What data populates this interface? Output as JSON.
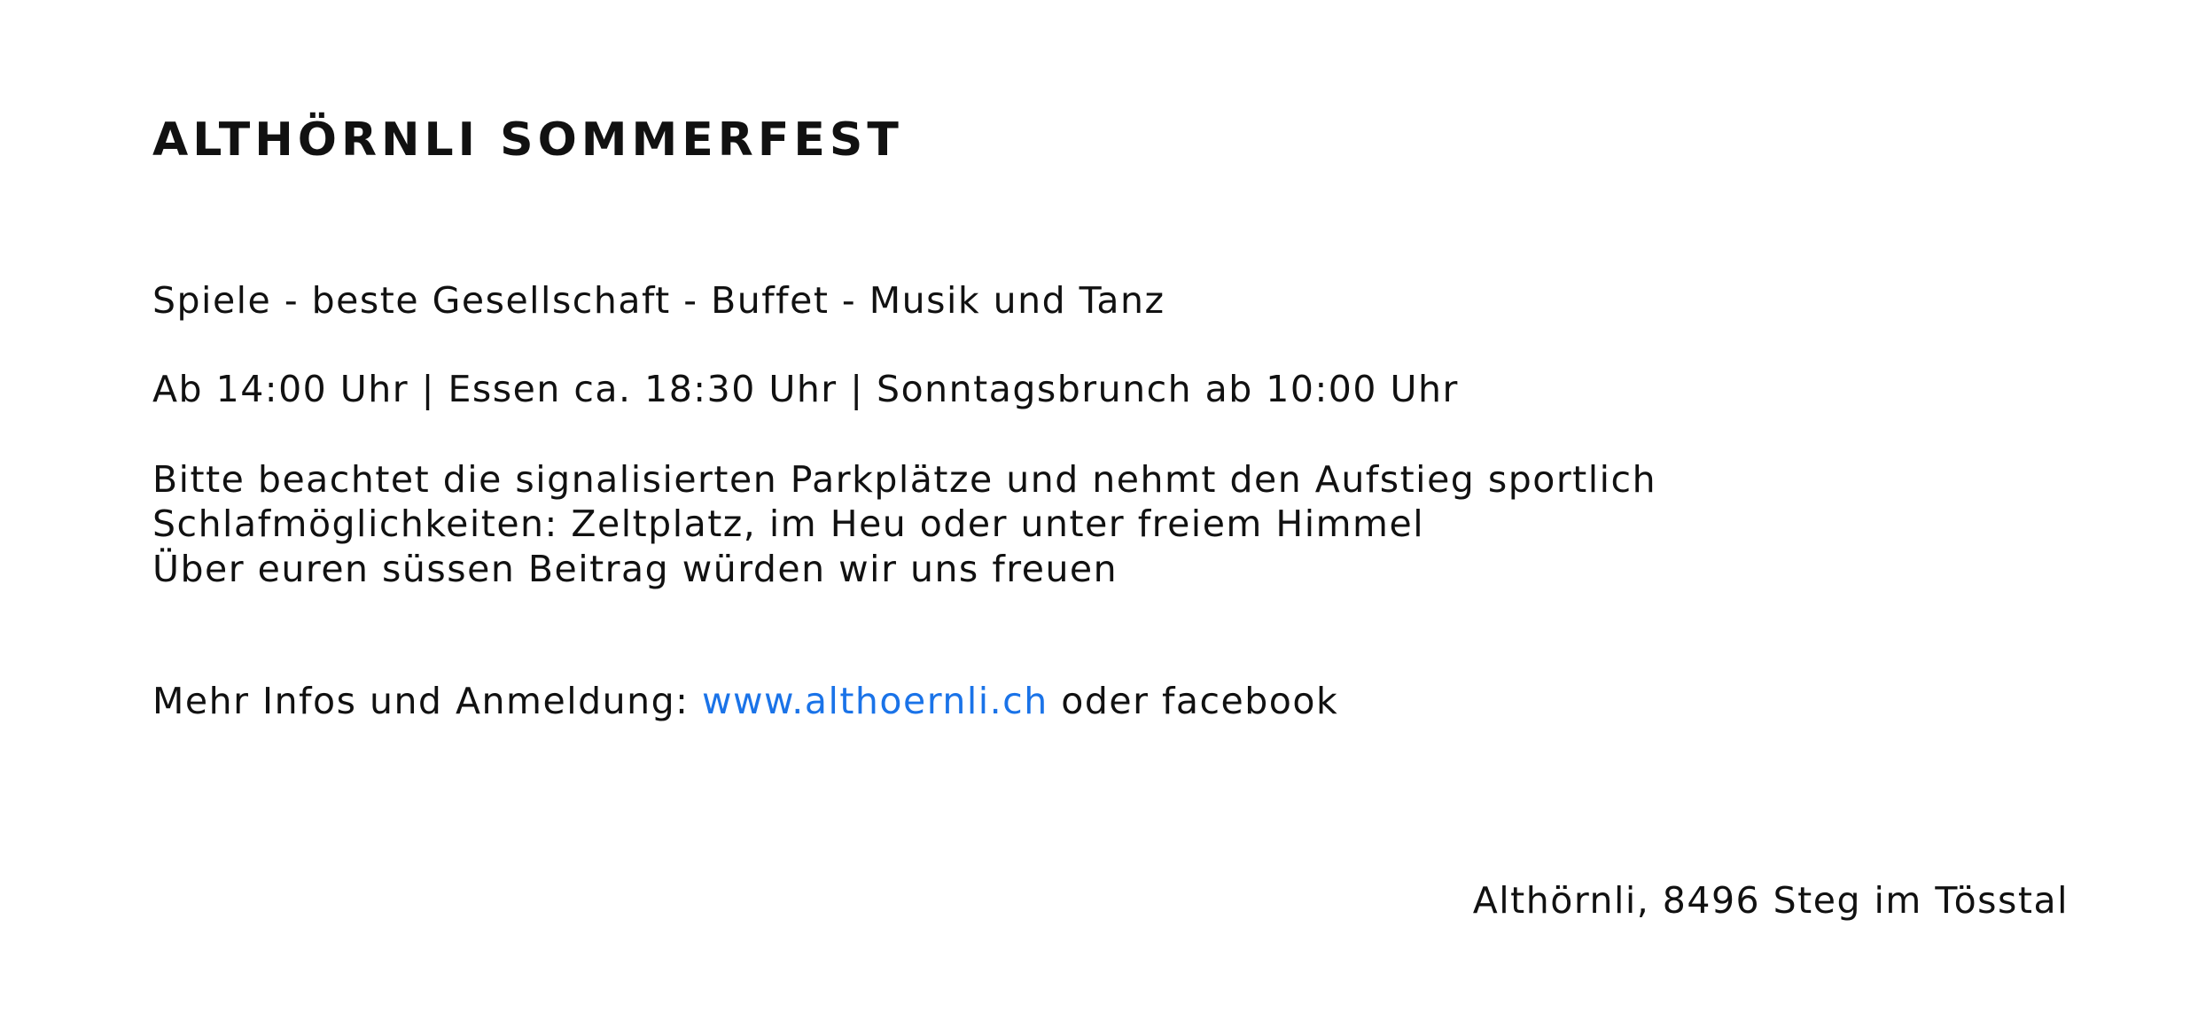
{
  "title": "ALTHÖRNLI SOMMERFEST",
  "tagline": "Spiele - beste Gesellschaft - Buffet - Musik und Tanz",
  "times": "Ab 14:00 Uhr | Essen ca. 18:30 Uhr | Sonntagsbrunch ab 10:00 Uhr",
  "notes": [
    "Bitte beachtet die signalisierten Parkplätze und nehmt den Aufstieg sportlich",
    "Schlafmöglichkeiten: Zeltplatz, im Heu oder unter freiem Himmel",
    "Über euren süssen Beitrag würden wir uns freuen"
  ],
  "info": {
    "prefix": "Mehr Infos und Anmeldung:",
    "link_text": "www.althoernli.ch",
    "suffix": "oder facebook"
  },
  "address": "Althörnli, 8496 Steg im Tösstal",
  "colors": {
    "text": "#111111",
    "link": "#1a73e8",
    "background": "#ffffff"
  }
}
